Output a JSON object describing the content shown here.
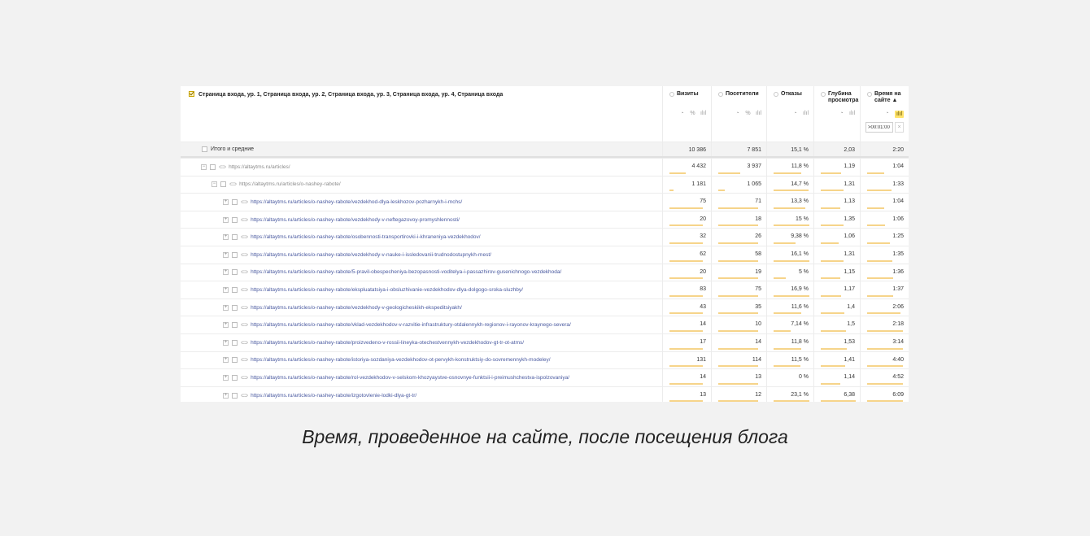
{
  "header": {
    "dimensions_label": "Страница входа, ур. 1, Страница входа, ур. 2, Страница входа, ур. 3, Страница входа, ур. 4, Страница входа",
    "columns": [
      {
        "key": "visits",
        "title": "Визиты",
        "icons": [
          "◔",
          "%",
          "ılıl"
        ]
      },
      {
        "key": "visitors",
        "title": "Посетители",
        "icons": [
          "◔",
          "%",
          "ılıl"
        ]
      },
      {
        "key": "bounce",
        "title": "Отказы",
        "icons": [
          "◔",
          "ılıl"
        ]
      },
      {
        "key": "depth",
        "title": "Глубина просмотра",
        "icons": [
          "◔",
          "ılıl"
        ]
      },
      {
        "key": "time",
        "title": "Время на сайте ▲",
        "icons": [
          "◔",
          "ılıl"
        ]
      }
    ],
    "filter_value": ">00:01:00",
    "filter_clear": "×"
  },
  "totals": {
    "label": "Итого и средние",
    "values": [
      "10 386",
      "7 851",
      "15,1 %",
      "2,03",
      "2:20"
    ]
  },
  "rows": [
    {
      "url": "https://altaytms.ru/articles/",
      "level": 1,
      "expander": "−",
      "visits": "4 432",
      "visitors": "3 937",
      "bounce": "11,8 %",
      "depth": "1,19",
      "time": "1:04",
      "bar_visits": 0.43,
      "bar_visitors": 0.5,
      "bar_bounce": 0.78,
      "bar_depth": 0.57,
      "bar_time": 0.46
    },
    {
      "url": "https://altaytms.ru/articles/o-nashey-rabote/",
      "level": 2,
      "expander": "−",
      "visits": "1 181",
      "visitors": "1 065",
      "bounce": "14,7 %",
      "depth": "1,31",
      "time": "1:33",
      "bar_visits": 0.11,
      "bar_visitors": 0.14,
      "bar_bounce": 0.97,
      "bar_depth": 0.65,
      "bar_time": 0.66
    },
    {
      "url": "https://altaytms.ru/articles/o-nashey-rabote/vezdekhod-dlya-leskhozov-pozharnykh-i-mchs/",
      "level": 3,
      "expander": "+",
      "visits": "75",
      "visitors": "71",
      "bounce": "13,3 %",
      "depth": "1,13",
      "time": "1:04",
      "bar_visits": 0.9,
      "bar_visitors": 0.9,
      "bar_bounce": 0.88,
      "bar_depth": 0.55,
      "bar_time": 0.46
    },
    {
      "url": "https://altaytms.ru/articles/o-nashey-rabote/vezdekhody-v-neftegazovoy-promyshlennosti/",
      "level": 3,
      "expander": "+",
      "visits": "20",
      "visitors": "18",
      "bounce": "15 %",
      "depth": "1,35",
      "time": "1:06",
      "bar_visits": 0.9,
      "bar_visitors": 0.9,
      "bar_bounce": 0.99,
      "bar_depth": 0.66,
      "bar_time": 0.47
    },
    {
      "url": "https://altaytms.ru/articles/o-nashey-rabote/osobennosti-transportirovki-i-khraneniya-vezdekhodov/",
      "level": 3,
      "expander": "+",
      "visits": "32",
      "visitors": "26",
      "bounce": "9,38 %",
      "depth": "1,06",
      "time": "1:25",
      "bar_visits": 0.9,
      "bar_visitors": 0.9,
      "bar_bounce": 0.62,
      "bar_depth": 0.52,
      "bar_time": 0.6
    },
    {
      "url": "https://altaytms.ru/articles/o-nashey-rabote/vezdekhody-v-nauke-i-issledovanii-trudnodostupnykh-mest/",
      "level": 3,
      "expander": "+",
      "visits": "62",
      "visitors": "58",
      "bounce": "16,1 %",
      "depth": "1,31",
      "time": "1:35",
      "bar_visits": 0.9,
      "bar_visitors": 0.9,
      "bar_bounce": 1.0,
      "bar_depth": 0.65,
      "bar_time": 0.68
    },
    {
      "url": "https://altaytms.ru/articles/o-nashey-rabote/5-pravil-obespecheniya-bezopasnosti-voditelya-i-passazhirov-gusenichnogo-vezdekhoda/",
      "level": 3,
      "expander": "+",
      "visits": "20",
      "visitors": "19",
      "bounce": "5 %",
      "depth": "1,15",
      "time": "1:36",
      "bar_visits": 0.9,
      "bar_visitors": 0.9,
      "bar_bounce": 0.33,
      "bar_depth": 0.56,
      "bar_time": 0.69
    },
    {
      "url": "https://altaytms.ru/articles/o-nashey-rabote/ekspluatatsiya-i-obsluzhivanie-vezdekhodov-dlya-dolgogo-sroka-sluzhby/",
      "level": 3,
      "expander": "+",
      "visits": "83",
      "visitors": "75",
      "bounce": "16,9 %",
      "depth": "1,17",
      "time": "1:37",
      "bar_visits": 0.9,
      "bar_visitors": 0.9,
      "bar_bounce": 1.0,
      "bar_depth": 0.57,
      "bar_time": 0.7
    },
    {
      "url": "https://altaytms.ru/articles/o-nashey-rabote/vezdekhody-v-geologicheskikh-ekspeditsiyakh/",
      "level": 3,
      "expander": "+",
      "visits": "43",
      "visitors": "35",
      "bounce": "11,6 %",
      "depth": "1,4",
      "time": "2:06",
      "bar_visits": 0.9,
      "bar_visitors": 0.9,
      "bar_bounce": 0.77,
      "bar_depth": 0.68,
      "bar_time": 0.9
    },
    {
      "url": "https://altaytms.ru/articles/o-nashey-rabote/vklad-vezdekhodov-v-razvitie-infrastruktury-otdalennykh-regionov-i-rayonov-kraynego-severa/",
      "level": 3,
      "expander": "+",
      "visits": "14",
      "visitors": "10",
      "bounce": "7,14 %",
      "depth": "1,5",
      "time": "2:18",
      "bar_visits": 0.9,
      "bar_visitors": 0.9,
      "bar_bounce": 0.47,
      "bar_depth": 0.73,
      "bar_time": 0.95
    },
    {
      "url": "https://altaytms.ru/articles/o-nashey-rabote/proizvedeno-v-rossii-lineyka-otechestvennykh-vezdekhodov-gt-tr-ot-atms/",
      "level": 3,
      "expander": "+",
      "visits": "17",
      "visitors": "14",
      "bounce": "11,8 %",
      "depth": "1,53",
      "time": "3:14",
      "bar_visits": 0.9,
      "bar_visitors": 0.9,
      "bar_bounce": 0.78,
      "bar_depth": 0.75,
      "bar_time": 0.95
    },
    {
      "url": "https://altaytms.ru/articles/o-nashey-rabote/istoriya-sozdaniya-vezdekhodov-ot-pervykh-konstruktsiy-do-sovremennykh-modeley/",
      "level": 3,
      "expander": "+",
      "visits": "131",
      "visitors": "114",
      "bounce": "11,5 %",
      "depth": "1,41",
      "time": "4:40",
      "bar_visits": 0.9,
      "bar_visitors": 0.9,
      "bar_bounce": 0.76,
      "bar_depth": 0.69,
      "bar_time": 0.95
    },
    {
      "url": "https://altaytms.ru/articles/o-nashey-rabote/rol-vezdekhodov-v-selskom-khozyaystve-osnovnye-funktsii-i-preimushchestva-ispolzovaniya/",
      "level": 3,
      "expander": "+",
      "visits": "14",
      "visitors": "13",
      "bounce": "0 %",
      "depth": "1,14",
      "time": "4:52",
      "bar_visits": 0.9,
      "bar_visitors": 0.9,
      "bar_bounce": 0.0,
      "bar_depth": 0.56,
      "bar_time": 0.95
    },
    {
      "url": "https://altaytms.ru/articles/o-nashey-rabote/izgotovlenie-lodki-dlya-gt-tr/",
      "level": 3,
      "expander": "+",
      "visits": "13",
      "visitors": "12",
      "bounce": "23,1 %",
      "depth": "6,38",
      "time": "6:09",
      "bar_visits": 0.9,
      "bar_visitors": 0.9,
      "bar_bounce": 1.0,
      "bar_depth": 1.0,
      "bar_time": 0.95
    }
  ],
  "caption": "Время, проведенное на сайте, после посещения блога",
  "colors": {
    "background": "#f2f2f2",
    "link": "#4a5aa0",
    "bar": "#f6d48a",
    "highlight": "#ffe36b"
  }
}
